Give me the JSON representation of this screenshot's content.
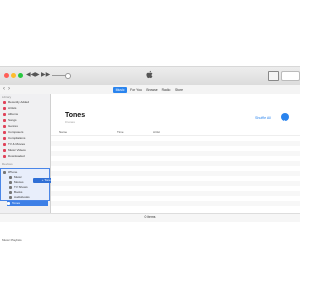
{
  "toolbar": {
    "playback": {
      "prev": "◀◀",
      "play": "▶",
      "next": "▶▶"
    }
  },
  "nav": {
    "back": "‹",
    "forward": "›",
    "tabs": [
      {
        "label": "Music",
        "active": true
      },
      {
        "label": "For You",
        "active": false
      },
      {
        "label": "Browse",
        "active": false
      },
      {
        "label": "Radio",
        "active": false
      },
      {
        "label": "Store",
        "active": false
      }
    ]
  },
  "sidebar": {
    "library_heading": "Library",
    "library_items": [
      "Recently Added",
      "Artists",
      "Albums",
      "Songs",
      "Genres",
      "Composers",
      "Compilations",
      "TV & Movies",
      "Music Videos",
      "Downloaded"
    ],
    "devices_heading": "Devices",
    "device_name": "iPhone",
    "device_items": [
      "Music",
      "Movies",
      "TV Shows",
      "Books",
      "Audiobooks",
      "Tones"
    ],
    "selected_item": "Tones",
    "drag_tooltip": "+ Tones",
    "footer": "Music Playlists"
  },
  "main": {
    "title": "Tones",
    "subtitle": "0 tones",
    "shuffle_label": "Shuffle All",
    "columns": [
      "Name",
      "Time",
      "Artist"
    ]
  },
  "status": {
    "text": "0 items"
  },
  "colors": {
    "accent": "#2a84ee",
    "sidebar_selection": "#3d7fe6"
  }
}
